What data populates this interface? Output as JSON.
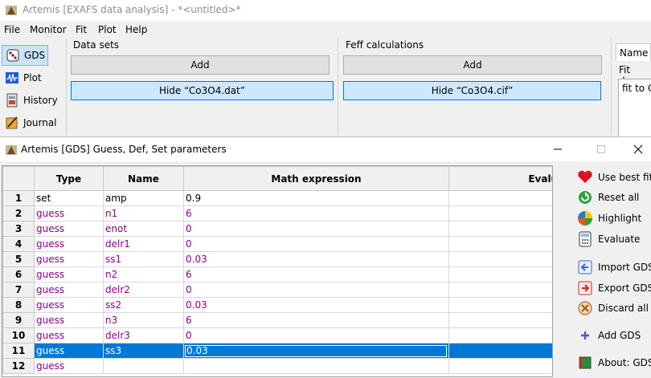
{
  "main_window": {
    "title": "Artemis [EXAFS data analysis] - *<untitled>*"
  },
  "menu": [
    "File",
    "Monitor",
    "Fit",
    "Plot",
    "Help"
  ],
  "sidebar": [
    {
      "label": "GDS",
      "icon": "dice-icon",
      "active": true
    },
    {
      "label": "Plot",
      "icon": "waveform-icon",
      "active": false
    },
    {
      "label": "History",
      "icon": "history-icon",
      "active": false
    },
    {
      "label": "Journal",
      "icon": "journal-icon",
      "active": false
    }
  ],
  "data_sets": {
    "label": "Data sets",
    "add_label": "Add",
    "hide_label": "Hide “Co3O4.dat”"
  },
  "feff": {
    "label": "Feff calculations",
    "add_label": "Add",
    "hide_label": "Hide “Co3O4.cif”"
  },
  "right_panel": {
    "tab_label": "Name",
    "fit_desc_label": "Fit desc",
    "fit_desc_value": "fit to C"
  },
  "gds_window": {
    "title": "Artemis [GDS] Guess, Def, Set parameters",
    "columns": [
      "Type",
      "Name",
      "Math expression",
      "Evaluated"
    ],
    "rows": [
      {
        "num": "1",
        "type": "set",
        "name": "amp",
        "math": "0.9",
        "evaluated": ""
      },
      {
        "num": "2",
        "type": "guess",
        "name": "n1",
        "math": "6",
        "evaluated": ""
      },
      {
        "num": "3",
        "type": "guess",
        "name": "enot",
        "math": "0",
        "evaluated": ""
      },
      {
        "num": "4",
        "type": "guess",
        "name": "delr1",
        "math": "0",
        "evaluated": ""
      },
      {
        "num": "5",
        "type": "guess",
        "name": "ss1",
        "math": "0.03",
        "evaluated": ""
      },
      {
        "num": "6",
        "type": "guess",
        "name": "n2",
        "math": "6",
        "evaluated": ""
      },
      {
        "num": "7",
        "type": "guess",
        "name": "delr2",
        "math": "0",
        "evaluated": ""
      },
      {
        "num": "8",
        "type": "guess",
        "name": "ss2",
        "math": "0.03",
        "evaluated": ""
      },
      {
        "num": "9",
        "type": "guess",
        "name": "n3",
        "math": "6",
        "evaluated": ""
      },
      {
        "num": "10",
        "type": "guess",
        "name": "delr3",
        "math": "0",
        "evaluated": ""
      },
      {
        "num": "11",
        "type": "guess",
        "name": "ss3",
        "math": "0.03",
        "evaluated": "",
        "selected": true
      },
      {
        "num": "12",
        "type": "guess",
        "name": "",
        "math": "",
        "evaluated": ""
      }
    ],
    "tools": [
      {
        "label": "Use best fit",
        "icon": "heart-icon"
      },
      {
        "label": "Reset all",
        "icon": "reset-icon"
      },
      {
        "label": "Highlight",
        "icon": "pinwheel-icon"
      },
      {
        "label": "Evaluate",
        "icon": "calculator-icon"
      },
      {
        "label": "Import GDS",
        "icon": "import-icon"
      },
      {
        "label": "Export GDS",
        "icon": "export-icon"
      },
      {
        "label": "Discard all",
        "icon": "discard-icon"
      },
      {
        "label": "Add GDS",
        "icon": "plus-icon"
      },
      {
        "label": "About: GDS",
        "icon": "book-icon"
      }
    ]
  },
  "colors": {
    "guess": "#8b008b",
    "selection": "#0078d7",
    "active_button": "#cce8ff"
  }
}
